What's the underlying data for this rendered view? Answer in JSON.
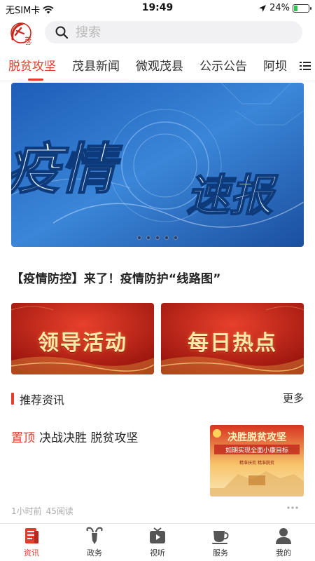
{
  "status_bar": {
    "carrier": "无SIM卡",
    "time": "19:49",
    "battery_percent": "24%",
    "battery_level": 0.24
  },
  "header": {
    "logo_text": "茂县",
    "search_placeholder": "搜索"
  },
  "tabs": [
    {
      "label": "脱贫攻坚",
      "active": true
    },
    {
      "label": "茂县新闻",
      "active": false
    },
    {
      "label": "微观茂县",
      "active": false
    },
    {
      "label": "公示公告",
      "active": false
    },
    {
      "label": "阿坝",
      "active": false
    }
  ],
  "banner": {
    "text_1": "疫情",
    "text_2": "速报",
    "slide_count": 5,
    "active_slide": 0
  },
  "headline": "【疫情防控】来了！疫情防护“线路图”",
  "feature_cards": [
    {
      "label": "领导活动"
    },
    {
      "label": "每日热点"
    }
  ],
  "recommend": {
    "title": "推荐资讯",
    "more": "更多",
    "items": [
      {
        "pin": "置顶",
        "title": "决战决胜 脱贫攻坚",
        "time": "1小时前",
        "reads": "45阅读",
        "thumb_text_1": "决胜脱贫攻坚",
        "thumb_text_2": "如期实现全面小康目标",
        "thumb_text_3": "精准扶贫  精准脱贫"
      }
    ]
  },
  "bottom_nav": [
    {
      "label": "资讯",
      "icon": "news-icon",
      "active": true
    },
    {
      "label": "政务",
      "icon": "goat-icon",
      "active": false
    },
    {
      "label": "视听",
      "icon": "tv-icon",
      "active": false
    },
    {
      "label": "服务",
      "icon": "cup-icon",
      "active": false
    },
    {
      "label": "我的",
      "icon": "user-icon",
      "active": false
    }
  ],
  "colors": {
    "accent": "#e33b2c",
    "banner_blue": "#2f6fc4",
    "card_red": "#b81d12"
  }
}
